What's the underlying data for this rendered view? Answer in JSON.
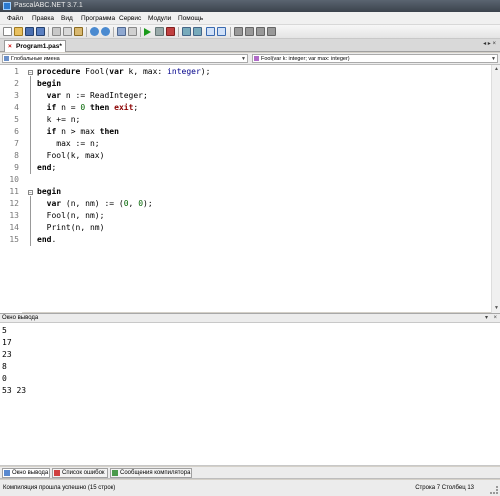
{
  "window": {
    "title": "PascalABC.NET 3.7.1"
  },
  "menu": [
    "Файл",
    "Правка",
    "Вид",
    "Программа",
    "Сервис",
    "Модули",
    "Помощь"
  ],
  "tab": {
    "label": "Program1.pas*"
  },
  "dropdowns": {
    "scope": "Глобальные имена",
    "member": "Fool(var k: integer; var max: integer)"
  },
  "code_lines": [
    "procedure Fool(var k, max: integer);",
    "begin",
    "  var n := ReadInteger;",
    "  if n = 0 then exit;",
    "  k += n;",
    "  if n > max then",
    "    max := n;",
    "  Fool(k, max)",
    "end;",
    "",
    "begin",
    "  var (n, nm) := (0, 0);",
    "  Fool(n, nm);",
    "  Print(n, nm)",
    "end."
  ],
  "line_numbers": [
    "1",
    "2",
    "3",
    "4",
    "5",
    "6",
    "7",
    "8",
    "9",
    "10",
    "11",
    "12",
    "13",
    "14",
    "15"
  ],
  "output": {
    "title": "Окно вывода",
    "lines": [
      "5",
      "17",
      "23",
      "8",
      "0",
      "53 23"
    ]
  },
  "bottom_tabs": [
    "Окно вывода",
    "Список ошибок",
    "Сообщения компилятора"
  ],
  "status": {
    "message": "Компиляция прошла успешно (15 строк)",
    "row_label": "Строка",
    "row": "7",
    "col_label": "Столбец",
    "col": "13"
  },
  "colors": {
    "keyword_red": "#8b0000",
    "type_blue": "#00008b",
    "number_green": "#006400"
  }
}
